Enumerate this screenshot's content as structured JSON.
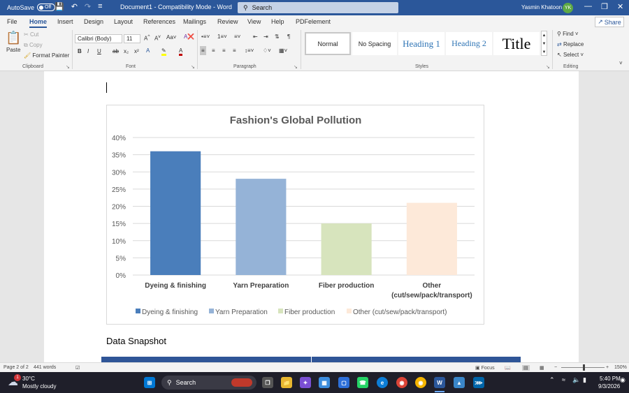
{
  "titlebar": {
    "autosave_label": "AutoSave",
    "autosave_state": "Off",
    "document_title": "Document1  -  Compatibility Mode  -  Word",
    "search_placeholder": "Search",
    "user_name": "Yasmin Khatoon",
    "user_initials": "YK"
  },
  "menu": {
    "items": [
      "File",
      "Home",
      "Insert",
      "Design",
      "Layout",
      "References",
      "Mailings",
      "Review",
      "View",
      "Help",
      "PDFelement"
    ],
    "active": "Home",
    "share_label": "Share"
  },
  "ribbon": {
    "clipboard": {
      "paste": "Paste",
      "cut": "Cut",
      "copy": "Copy",
      "format_painter": "Format Painter",
      "group_label": "Clipboard"
    },
    "font": {
      "font_name": "Calibri (Body)",
      "font_size": "11",
      "group_label": "Font"
    },
    "paragraph": {
      "group_label": "Paragraph"
    },
    "styles": {
      "items": [
        "Normal",
        "No Spacing",
        "Heading 1",
        "Heading 2",
        "Title"
      ],
      "group_label": "Styles"
    },
    "editing": {
      "find": "Find",
      "replace": "Replace",
      "select": "Select",
      "group_label": "Editing"
    }
  },
  "document": {
    "section_heading": "Data Snapshot"
  },
  "chart_data": {
    "type": "bar",
    "title": "Fashion's Global Pollution",
    "categories": [
      "Dyeing & finishing",
      "Yarn Preparation",
      "Fiber production",
      "Other (cut/sew/pack/transport)"
    ],
    "category_lines": [
      [
        "Dyeing & finishing"
      ],
      [
        "Yarn Preparation"
      ],
      [
        "Fiber production"
      ],
      [
        "Other",
        "(cut/sew/pack/transport)"
      ]
    ],
    "values": [
      0.36,
      0.28,
      0.15,
      0.21
    ],
    "colors": [
      "#4a7ebb",
      "#95b3d7",
      "#d7e4bd",
      "#fde9d9"
    ],
    "legend": [
      "Dyeing & finishing",
      "Yarn Preparation",
      "Fiber production",
      "Other   (cut/sew/pack/transport)"
    ],
    "legend_position": "bottom",
    "yticks": [
      "0%",
      "5%",
      "10%",
      "15%",
      "20%",
      "25%",
      "30%",
      "35%",
      "40%"
    ],
    "ylim": [
      0,
      0.4
    ],
    "grid": true
  },
  "statusbar": {
    "page": "Page 2 of 2",
    "words": "441 words",
    "focus": "Focus",
    "zoom": "150%"
  },
  "taskbar": {
    "temperature": "30°C",
    "weather": "Mostly cloudy",
    "weather_badge": "1",
    "search_label": "Search",
    "time": "5:40 PM",
    "date": "9/3/2026"
  }
}
